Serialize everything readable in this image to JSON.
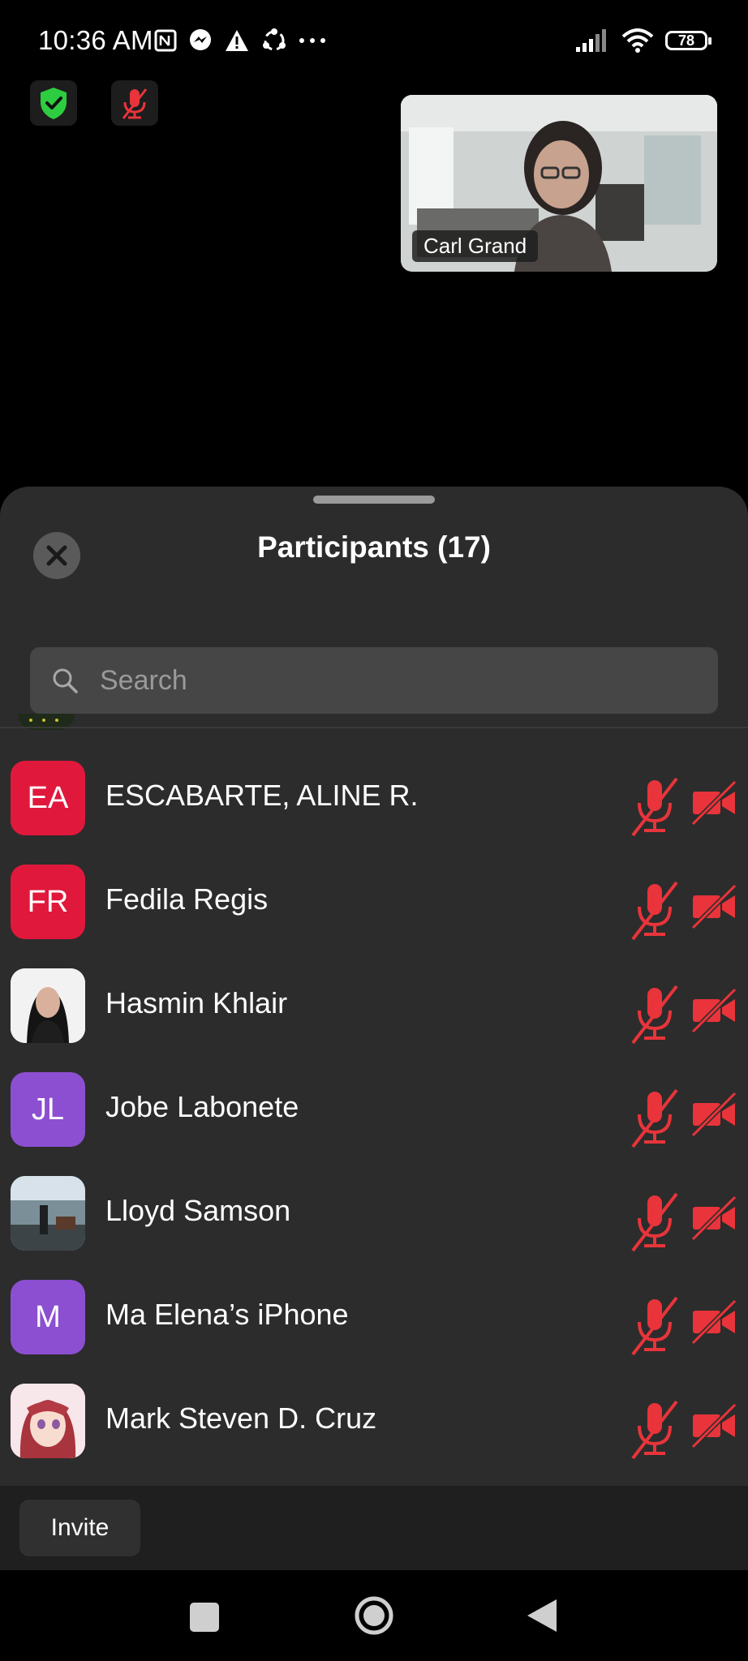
{
  "status_bar": {
    "time": "10:36 AM",
    "battery": "78"
  },
  "video": {
    "name": "Carl Grand"
  },
  "sheet": {
    "title": "Participants (17)",
    "search_placeholder": "Search"
  },
  "participants": [
    {
      "initials": "EA",
      "name": "ESCABARTE, ALINE R.",
      "avatar_color": "#e0193c",
      "photo": false
    },
    {
      "initials": "FR",
      "name": "Fedila Regis",
      "avatar_color": "#e0193c",
      "photo": false
    },
    {
      "initials": "",
      "name": "Hasmin Khlair",
      "avatar_color": "#f2f2f2",
      "photo": true,
      "photo_kind": "portrait"
    },
    {
      "initials": "JL",
      "name": "Jobe Labonete",
      "avatar_color": "#8c4fd1",
      "photo": false
    },
    {
      "initials": "",
      "name": "Lloyd Samson",
      "avatar_color": "#6e8aa0",
      "photo": true,
      "photo_kind": "scene"
    },
    {
      "initials": "M",
      "name": "Ma Elena’s iPhone",
      "avatar_color": "#8c4fd1",
      "photo": false
    },
    {
      "initials": "",
      "name": "Mark Steven D. Cruz",
      "avatar_color": "#f4d7dc",
      "photo": true,
      "photo_kind": "anime"
    }
  ],
  "footer": {
    "invite_label": "Invite"
  },
  "colors": {
    "muted_red": "#e8343a",
    "shield_green": "#2ecc40"
  }
}
